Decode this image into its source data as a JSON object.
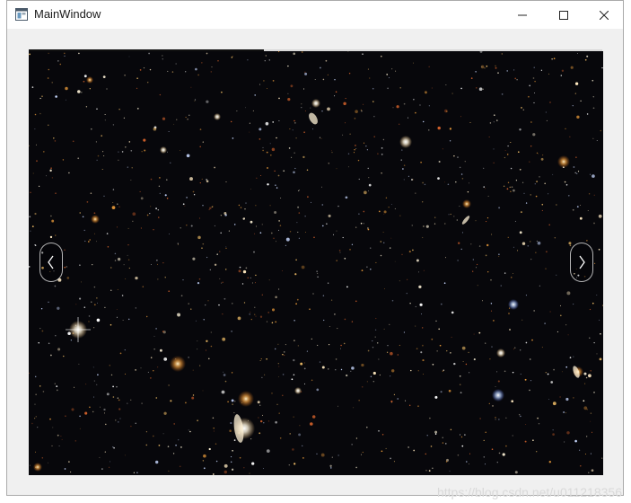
{
  "window": {
    "title": "MainWindow",
    "icon": "app-window-icon",
    "controls": {
      "minimize_icon": "minimize-icon",
      "maximize_icon": "maximize-icon",
      "close_icon": "close-icon"
    }
  },
  "carousel": {
    "progress_fraction": 0.41,
    "image_subject": "deep field star galaxy image",
    "prev_icon": "chevron-left-icon",
    "next_icon": "chevron-right-icon",
    "prev_glyph": "‹",
    "next_glyph": "›"
  },
  "watermark": {
    "text": "https://blog.csdn.net/u011218356"
  }
}
